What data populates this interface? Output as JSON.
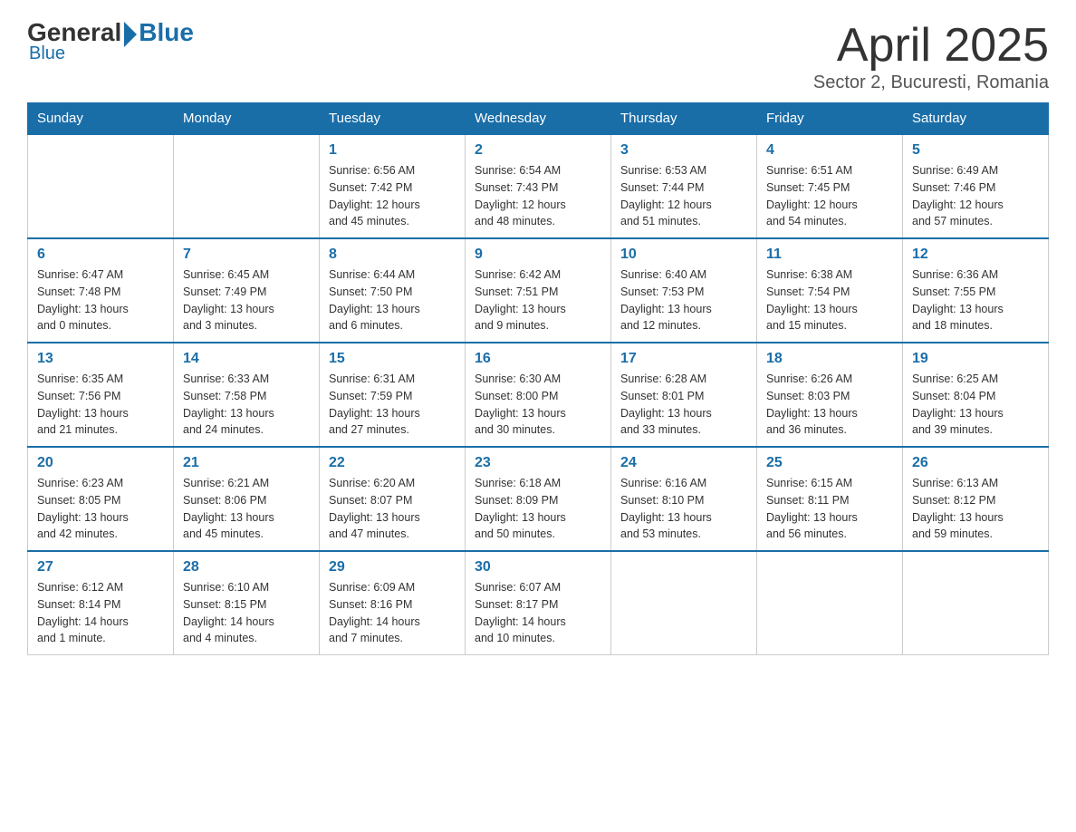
{
  "logo": {
    "general": "General",
    "blue": "Blue"
  },
  "header": {
    "title": "April 2025",
    "location": "Sector 2, Bucuresti, Romania"
  },
  "days_of_week": [
    "Sunday",
    "Monday",
    "Tuesday",
    "Wednesday",
    "Thursday",
    "Friday",
    "Saturday"
  ],
  "weeks": [
    [
      {
        "day": "",
        "info": ""
      },
      {
        "day": "",
        "info": ""
      },
      {
        "day": "1",
        "info": "Sunrise: 6:56 AM\nSunset: 7:42 PM\nDaylight: 12 hours\nand 45 minutes."
      },
      {
        "day": "2",
        "info": "Sunrise: 6:54 AM\nSunset: 7:43 PM\nDaylight: 12 hours\nand 48 minutes."
      },
      {
        "day": "3",
        "info": "Sunrise: 6:53 AM\nSunset: 7:44 PM\nDaylight: 12 hours\nand 51 minutes."
      },
      {
        "day": "4",
        "info": "Sunrise: 6:51 AM\nSunset: 7:45 PM\nDaylight: 12 hours\nand 54 minutes."
      },
      {
        "day": "5",
        "info": "Sunrise: 6:49 AM\nSunset: 7:46 PM\nDaylight: 12 hours\nand 57 minutes."
      }
    ],
    [
      {
        "day": "6",
        "info": "Sunrise: 6:47 AM\nSunset: 7:48 PM\nDaylight: 13 hours\nand 0 minutes."
      },
      {
        "day": "7",
        "info": "Sunrise: 6:45 AM\nSunset: 7:49 PM\nDaylight: 13 hours\nand 3 minutes."
      },
      {
        "day": "8",
        "info": "Sunrise: 6:44 AM\nSunset: 7:50 PM\nDaylight: 13 hours\nand 6 minutes."
      },
      {
        "day": "9",
        "info": "Sunrise: 6:42 AM\nSunset: 7:51 PM\nDaylight: 13 hours\nand 9 minutes."
      },
      {
        "day": "10",
        "info": "Sunrise: 6:40 AM\nSunset: 7:53 PM\nDaylight: 13 hours\nand 12 minutes."
      },
      {
        "day": "11",
        "info": "Sunrise: 6:38 AM\nSunset: 7:54 PM\nDaylight: 13 hours\nand 15 minutes."
      },
      {
        "day": "12",
        "info": "Sunrise: 6:36 AM\nSunset: 7:55 PM\nDaylight: 13 hours\nand 18 minutes."
      }
    ],
    [
      {
        "day": "13",
        "info": "Sunrise: 6:35 AM\nSunset: 7:56 PM\nDaylight: 13 hours\nand 21 minutes."
      },
      {
        "day": "14",
        "info": "Sunrise: 6:33 AM\nSunset: 7:58 PM\nDaylight: 13 hours\nand 24 minutes."
      },
      {
        "day": "15",
        "info": "Sunrise: 6:31 AM\nSunset: 7:59 PM\nDaylight: 13 hours\nand 27 minutes."
      },
      {
        "day": "16",
        "info": "Sunrise: 6:30 AM\nSunset: 8:00 PM\nDaylight: 13 hours\nand 30 minutes."
      },
      {
        "day": "17",
        "info": "Sunrise: 6:28 AM\nSunset: 8:01 PM\nDaylight: 13 hours\nand 33 minutes."
      },
      {
        "day": "18",
        "info": "Sunrise: 6:26 AM\nSunset: 8:03 PM\nDaylight: 13 hours\nand 36 minutes."
      },
      {
        "day": "19",
        "info": "Sunrise: 6:25 AM\nSunset: 8:04 PM\nDaylight: 13 hours\nand 39 minutes."
      }
    ],
    [
      {
        "day": "20",
        "info": "Sunrise: 6:23 AM\nSunset: 8:05 PM\nDaylight: 13 hours\nand 42 minutes."
      },
      {
        "day": "21",
        "info": "Sunrise: 6:21 AM\nSunset: 8:06 PM\nDaylight: 13 hours\nand 45 minutes."
      },
      {
        "day": "22",
        "info": "Sunrise: 6:20 AM\nSunset: 8:07 PM\nDaylight: 13 hours\nand 47 minutes."
      },
      {
        "day": "23",
        "info": "Sunrise: 6:18 AM\nSunset: 8:09 PM\nDaylight: 13 hours\nand 50 minutes."
      },
      {
        "day": "24",
        "info": "Sunrise: 6:16 AM\nSunset: 8:10 PM\nDaylight: 13 hours\nand 53 minutes."
      },
      {
        "day": "25",
        "info": "Sunrise: 6:15 AM\nSunset: 8:11 PM\nDaylight: 13 hours\nand 56 minutes."
      },
      {
        "day": "26",
        "info": "Sunrise: 6:13 AM\nSunset: 8:12 PM\nDaylight: 13 hours\nand 59 minutes."
      }
    ],
    [
      {
        "day": "27",
        "info": "Sunrise: 6:12 AM\nSunset: 8:14 PM\nDaylight: 14 hours\nand 1 minute."
      },
      {
        "day": "28",
        "info": "Sunrise: 6:10 AM\nSunset: 8:15 PM\nDaylight: 14 hours\nand 4 minutes."
      },
      {
        "day": "29",
        "info": "Sunrise: 6:09 AM\nSunset: 8:16 PM\nDaylight: 14 hours\nand 7 minutes."
      },
      {
        "day": "30",
        "info": "Sunrise: 6:07 AM\nSunset: 8:17 PM\nDaylight: 14 hours\nand 10 minutes."
      },
      {
        "day": "",
        "info": ""
      },
      {
        "day": "",
        "info": ""
      },
      {
        "day": "",
        "info": ""
      }
    ]
  ]
}
